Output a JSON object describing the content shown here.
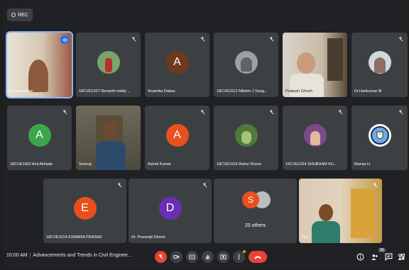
{
  "rec_label": "REC",
  "tiles": [
    {
      "name": "Dr.Harikumar",
      "avatar_letter": "",
      "avatar_color": "",
      "kind": "video-self"
    },
    {
      "name": "18CVE1027 Revanth reddy ...",
      "avatar_letter": "",
      "avatar_color": "",
      "kind": "photo"
    },
    {
      "name": "Anamika Dabas",
      "avatar_letter": "A",
      "avatar_color": "#6d3a1f",
      "kind": "letter"
    },
    {
      "name": "18CVE1012 Mikkim J Sang...",
      "avatar_letter": "",
      "avatar_color": "",
      "kind": "photo"
    },
    {
      "name": "Prakash Ghosh",
      "avatar_letter": "",
      "avatar_color": "",
      "kind": "video"
    },
    {
      "name": "Dr.Harikumar M",
      "avatar_letter": "",
      "avatar_color": "",
      "kind": "photo"
    },
    {
      "name": "19CVE1002 Anil Akhade",
      "avatar_letter": "A",
      "avatar_color": "#3ea64a",
      "kind": "letter"
    },
    {
      "name": "Sreeraj",
      "avatar_letter": "",
      "avatar_color": "",
      "kind": "video"
    },
    {
      "name": "Ashok Kumar",
      "avatar_letter": "A",
      "avatar_color": "#e8501e",
      "kind": "letter"
    },
    {
      "name": "18CVE1016 Rahul Shouri",
      "avatar_letter": "",
      "avatar_color": "",
      "kind": "photo"
    },
    {
      "name": "19CVE1024 SHUBHAM KU...",
      "avatar_letter": "",
      "avatar_color": "",
      "kind": "photo"
    },
    {
      "name": "Manas H",
      "avatar_letter": "",
      "avatar_color": "",
      "kind": "logo"
    },
    {
      "name": "18CVE1014 ESWARA PRASAD",
      "avatar_letter": "E",
      "avatar_color": "#e8501e",
      "kind": "letter"
    },
    {
      "name": "Dr. Prasenjit Ghosh",
      "avatar_letter": "D",
      "avatar_color": "#6a2fb3",
      "kind": "letter"
    },
    {
      "name": "20 others",
      "avatar_letter": "S",
      "avatar_color": "#e8501e",
      "kind": "others"
    },
    {
      "name": "You",
      "avatar_letter": "",
      "avatar_color": "",
      "kind": "video-you"
    }
  ],
  "bottom": {
    "time": "10:00 AM",
    "title": "Advancements and Trends in Civil Enginee...",
    "participants_count": "36"
  },
  "colors": {
    "accent_blue": "#1a73e8",
    "end_call_red": "#ea4335",
    "tile_bg": "#3c4043",
    "stage_bg": "#202124"
  },
  "icons": {
    "mic": "mic-off-icon",
    "camera": "camera-icon",
    "captions": "captions-icon",
    "hand": "raise-hand-icon",
    "present": "present-icon",
    "more": "more-vert-icon",
    "end": "end-call-icon",
    "info": "info-icon",
    "people": "people-icon",
    "chat": "chat-icon",
    "activities": "activities-icon"
  }
}
